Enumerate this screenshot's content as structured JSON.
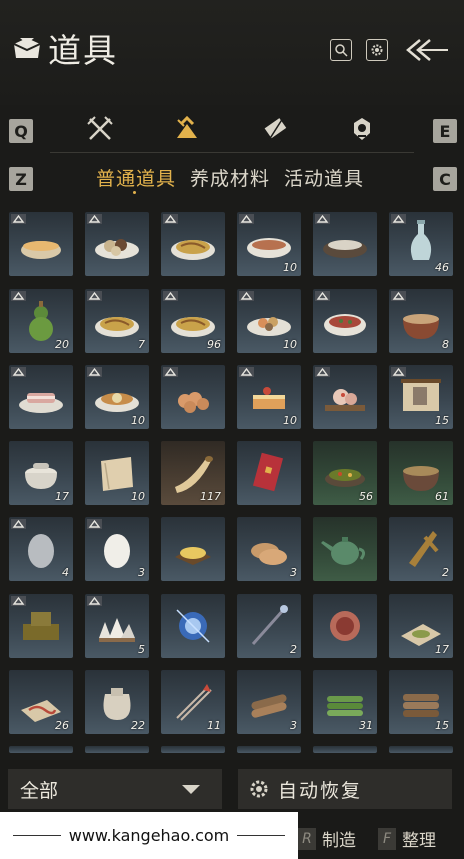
{
  "header": {
    "title": "道具"
  },
  "keys": {
    "q": "Q",
    "e": "E",
    "z": "Z",
    "c": "C"
  },
  "categories": [
    {
      "name": "weapons",
      "icon": "crossed-swords-icon"
    },
    {
      "name": "items",
      "icon": "bundle-icon"
    },
    {
      "name": "scrolls",
      "icon": "scroll-icon"
    },
    {
      "name": "treasures",
      "icon": "medal-icon"
    }
  ],
  "subtabs": [
    {
      "label": "普通道具",
      "active": true
    },
    {
      "label": "养成材料",
      "active": false
    },
    {
      "label": "活动道具",
      "active": false
    }
  ],
  "items": [
    {
      "icon": "porridge-bowl-icon",
      "qty": ""
    },
    {
      "icon": "dumplings-plate-icon",
      "qty": ""
    },
    {
      "icon": "noodles-plate-icon",
      "qty": ""
    },
    {
      "icon": "soup-bowl-icon",
      "qty": "10"
    },
    {
      "icon": "rice-bowl-icon",
      "qty": ""
    },
    {
      "icon": "vase-icon",
      "qty": "46"
    },
    {
      "icon": "gourd-bottle-icon",
      "qty": "20"
    },
    {
      "icon": "noodles-plate-icon",
      "qty": "7"
    },
    {
      "icon": "noodles-plate-icon",
      "qty": "96"
    },
    {
      "icon": "shrimp-plate-icon",
      "qty": "10"
    },
    {
      "icon": "stir-fry-bowl-icon",
      "qty": ""
    },
    {
      "icon": "clay-pot-icon",
      "qty": "8"
    },
    {
      "icon": "meat-slices-icon",
      "qty": ""
    },
    {
      "icon": "soup-plate-icon",
      "qty": "10"
    },
    {
      "icon": "buns-plate-icon",
      "qty": ""
    },
    {
      "icon": "layer-cake-icon",
      "qty": "10"
    },
    {
      "icon": "peach-buns-icon",
      "qty": ""
    },
    {
      "icon": "painting-scroll-icon",
      "qty": "15"
    },
    {
      "icon": "incense-pot-icon",
      "qty": "17"
    },
    {
      "icon": "book-icon",
      "qty": "10"
    },
    {
      "icon": "horn-icon",
      "qty": "117"
    },
    {
      "icon": "red-envelope-icon",
      "qty": ""
    },
    {
      "icon": "herbs-bowl-icon",
      "qty": "56"
    },
    {
      "icon": "stew-pot-icon",
      "qty": "61"
    },
    {
      "icon": "grey-egg-icon",
      "qty": "4"
    },
    {
      "icon": "white-egg-icon",
      "qty": "3"
    },
    {
      "icon": "grain-pile-icon",
      "qty": ""
    },
    {
      "icon": "flatbread-icon",
      "qty": "3"
    },
    {
      "icon": "teapot-icon",
      "qty": ""
    },
    {
      "icon": "set-square-icon",
      "qty": "2"
    },
    {
      "icon": "seal-block-icon",
      "qty": ""
    },
    {
      "icon": "salt-crystals-icon",
      "qty": "5"
    },
    {
      "icon": "spirit-orb-icon",
      "qty": ""
    },
    {
      "icon": "staff-icon",
      "qty": "2"
    },
    {
      "icon": "mirror-icon",
      "qty": ""
    },
    {
      "icon": "powder-paper-icon",
      "qty": "17"
    },
    {
      "icon": "worm-paper-icon",
      "qty": "26"
    },
    {
      "icon": "sack-icon",
      "qty": "22"
    },
    {
      "icon": "arrows-icon",
      "qty": "11"
    },
    {
      "icon": "logs-icon",
      "qty": "3"
    },
    {
      "icon": "bamboo-bundle-icon",
      "qty": "31"
    },
    {
      "icon": "firewood-icon",
      "qty": "15"
    }
  ],
  "filter": {
    "label": "全部"
  },
  "auto_recover": {
    "label": "自动恢复"
  },
  "watermark": {
    "url": "www.kangehao.com"
  },
  "actions": [
    {
      "key": "R",
      "label": "制造"
    },
    {
      "key": "F",
      "label": "整理"
    }
  ],
  "colors": {
    "accent": "#e2b24c",
    "cell_bg": "#3a4650"
  }
}
